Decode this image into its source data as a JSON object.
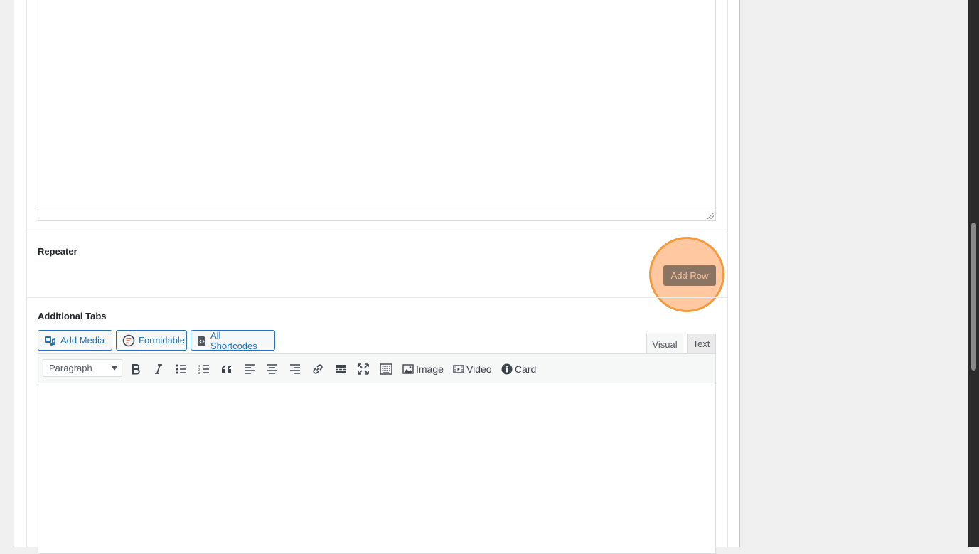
{
  "repeater": {
    "label": "Repeater",
    "add_row_label": "Add Row"
  },
  "additional_tabs": {
    "label": "Additional Tabs",
    "media_buttons": {
      "add_media": "Add Media",
      "formidable": "Formidable",
      "all_shortcodes": "All Shortcodes"
    },
    "tabs": {
      "visual": "Visual",
      "text": "Text"
    },
    "toolbar": {
      "format_select_value": "Paragraph",
      "image_label": "Image",
      "video_label": "Video",
      "card_label": "Card"
    }
  },
  "colors": {
    "accent": "#2271b1",
    "highlight_ring": "#f39a3c",
    "add_row_button": "#8b7562"
  }
}
